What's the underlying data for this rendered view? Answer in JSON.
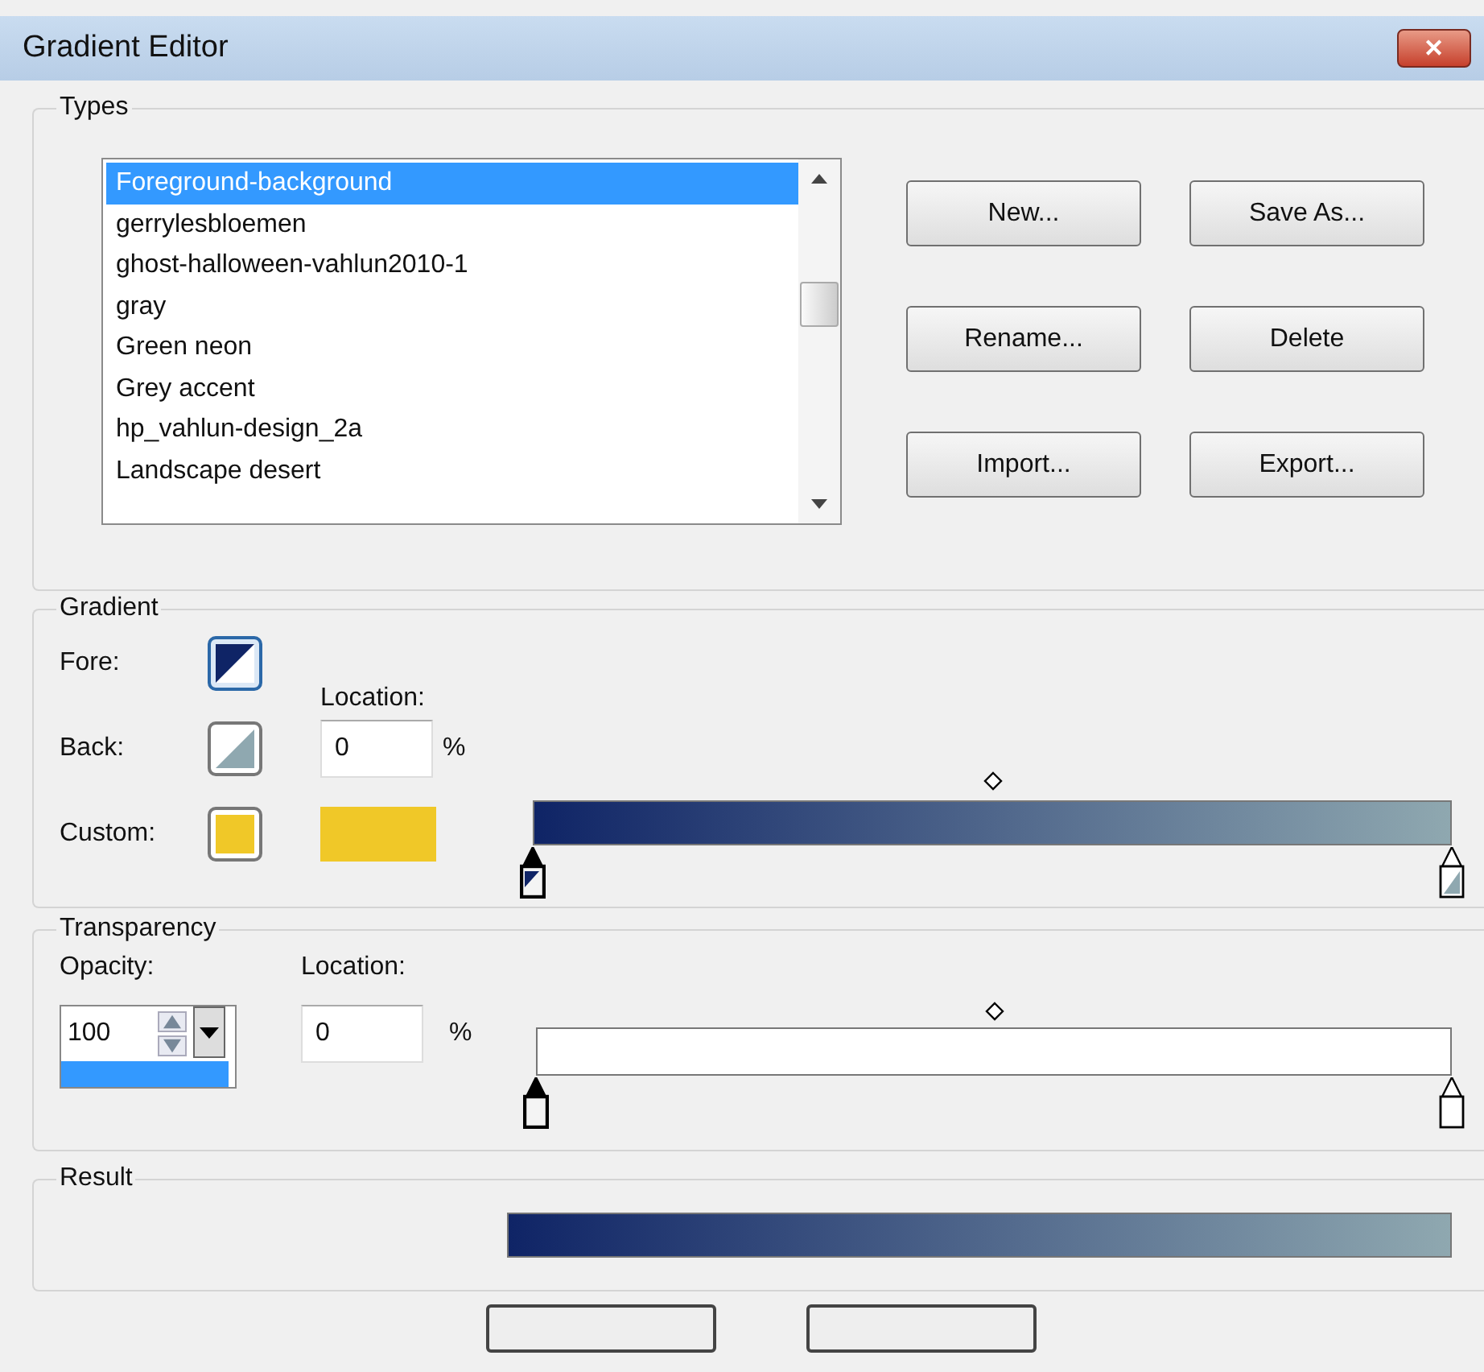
{
  "window": {
    "title": "Gradient Editor",
    "close": "✕"
  },
  "types": {
    "label": "Types",
    "items": [
      {
        "label": "Foreground-background",
        "selected": true
      },
      {
        "label": "gerrylesbloemen",
        "selected": false
      },
      {
        "label": "ghost-halloween-vahlun2010-1",
        "selected": false
      },
      {
        "label": "gray",
        "selected": false
      },
      {
        "label": "Green neon",
        "selected": false
      },
      {
        "label": "Grey accent",
        "selected": false
      },
      {
        "label": "hp_vahlun-design_2a",
        "selected": false
      },
      {
        "label": "Landscape desert",
        "selected": false
      }
    ],
    "buttons": [
      "New...",
      "Save As...",
      "Rename...",
      "Delete",
      "Import...",
      "Export..."
    ]
  },
  "gradient": {
    "label": "Gradient",
    "fore_label": "Fore:",
    "back_label": "Back:",
    "custom": {
      "label": "Custom:",
      "color": "#f0c828"
    },
    "location_label": "Location:",
    "location": "0",
    "unit": "%",
    "stops": [
      {
        "color": "#0f2466",
        "selected": true
      },
      {
        "color": "#8fa8b0",
        "selected": false
      }
    ]
  },
  "transparency": {
    "label": "Transparency",
    "opacity_label": "Opacity:",
    "opacity": "100",
    "location_label": "Location:",
    "location": "0",
    "unit": "%",
    "stops": [
      {
        "selected": true
      },
      {
        "selected": false
      }
    ]
  },
  "result": {
    "label": "Result"
  }
}
